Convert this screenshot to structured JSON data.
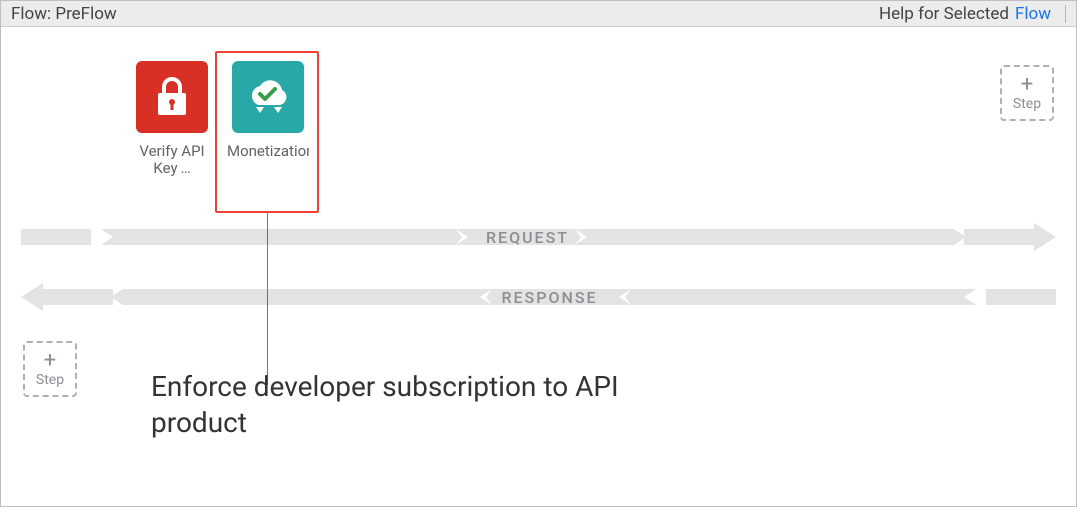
{
  "header": {
    "flow_prefix": "Flow:",
    "flow_name": "PreFlow",
    "help_label": "Help for Selected",
    "help_link_text": "Flow"
  },
  "policies": [
    {
      "id": "verify-api-key",
      "label": "Verify API Key …",
      "icon": "lock-icon",
      "selected": false
    },
    {
      "id": "monetization",
      "label": "Monetization- …",
      "icon": "cloud-check-icon",
      "selected": true
    }
  ],
  "flows": {
    "request_label": "REQUEST",
    "response_label": "RESPONSE"
  },
  "add_step_label": "Step",
  "callout": "Enforce developer subscription to API product",
  "colors": {
    "accent_red": "#d93025",
    "accent_teal": "#2aa8a8",
    "selection": "#ea4335",
    "link": "#1a73e8"
  }
}
